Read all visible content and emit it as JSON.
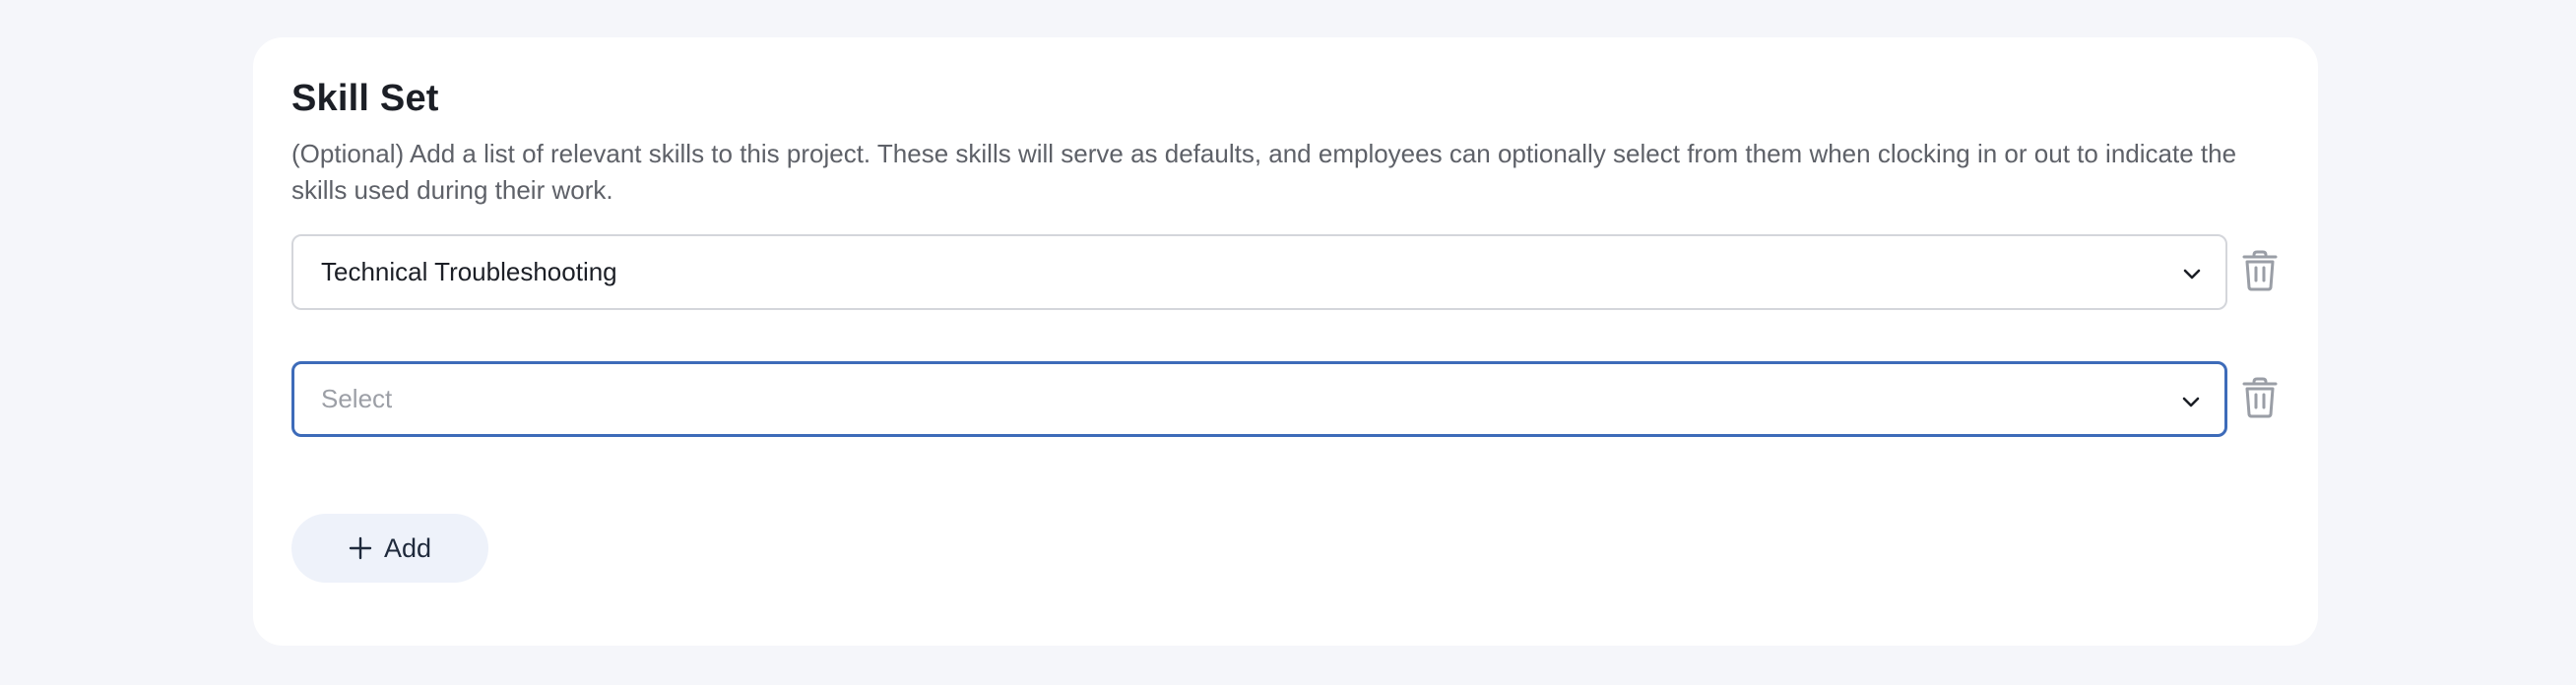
{
  "section": {
    "title": "Skill Set",
    "description": "(Optional) Add a list of relevant skills to this project. These skills will serve as defaults, and employees can optionally select from them when clocking in or out to indicate the skills used during their work."
  },
  "skills": [
    {
      "value": "Technical Troubleshooting",
      "placeholder": ""
    },
    {
      "value": "",
      "placeholder": "Select"
    }
  ],
  "add_button": {
    "label": "Add",
    "icon": "plus-icon"
  },
  "icons": {
    "dropdown": "chevron-down-icon",
    "delete": "trash-icon"
  },
  "colors": {
    "page_background": "#f5f6fa",
    "card_background": "#ffffff",
    "focus_border": "#3d6bb9",
    "add_button_background": "#eef2fa"
  }
}
